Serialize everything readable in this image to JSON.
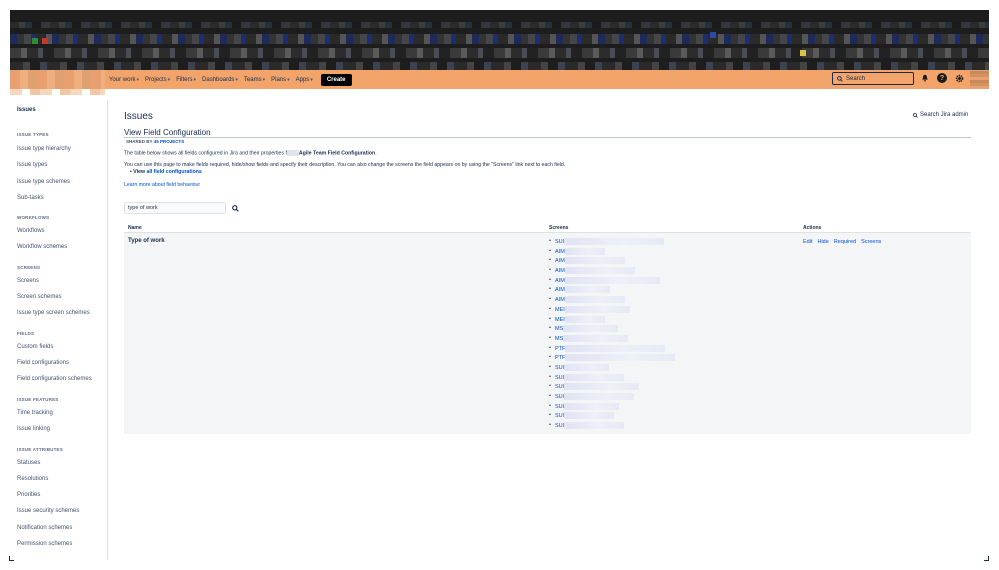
{
  "topnav": {
    "items": [
      {
        "label": "Your work"
      },
      {
        "label": "Projects"
      },
      {
        "label": "Filters"
      },
      {
        "label": "Dashboards"
      },
      {
        "label": "Teams"
      },
      {
        "label": "Plans"
      },
      {
        "label": "Apps"
      }
    ],
    "create_label": "Create",
    "search_placeholder": "Search",
    "icons": [
      "notifications-icon",
      "help-icon",
      "settings-icon"
    ],
    "nav_color": "#f3a46b"
  },
  "sidebar": {
    "title": "Issues",
    "sections": [
      {
        "heading": "ISSUE TYPES",
        "items": [
          "Issue type hierarchy",
          "Issue types",
          "Issue type schemes",
          "Sub-tasks"
        ]
      },
      {
        "heading": "WORKFLOWS",
        "items": [
          "Workflows",
          "Workflow schemes"
        ]
      },
      {
        "heading": "SCREENS",
        "items": [
          "Screens",
          "Screen schemes",
          "Issue type screen schemes"
        ]
      },
      {
        "heading": "FIELDS",
        "items": [
          "Custom fields",
          "Field configurations",
          "Field configuration schemes"
        ]
      },
      {
        "heading": "ISSUE FEATURES",
        "items": [
          "Time tracking",
          "Issue linking"
        ]
      },
      {
        "heading": "ISSUE ATTRIBUTES",
        "items": [
          "Statuses",
          "Resolutions",
          "Priorities",
          "Issue security schemes",
          "Notification schemes",
          "Permission schemes"
        ]
      }
    ]
  },
  "main": {
    "page_title": "Issues",
    "search_admin": "Search Jira admin",
    "sub_title": "View Field Configuration",
    "shared_by_prefix": "SHARED BY",
    "shared_by_link": "45 PROJECTS",
    "desc1_prefix": "The table below shows all fields configured in Jira and their properties f",
    "desc1_bold": "Agile Team Field Configuration",
    "desc1_suffix": ".",
    "desc2": "You can use this page to make fields required, hide/show fields and specify their description. You can also change the screens the field appears on by using the \"Screens\" link next to each field.",
    "view_all_prefix": "View",
    "view_all_link": "all field configurations",
    "learn_more": "Learn more about field behaviour",
    "filter_value": "type of work"
  },
  "table": {
    "headers": [
      "Name",
      "Screens",
      "Actions"
    ],
    "row": {
      "name": "Type of work",
      "screens": [
        "SUI",
        "AIM",
        "AIM",
        "AIM",
        "AIM",
        "AIM",
        "AIM",
        "MEI",
        "MEI",
        "MS",
        "MS",
        "PTF",
        "PTF",
        "SUI",
        "SUI",
        "SUI",
        "SUI",
        "SUI",
        "SUI",
        "SUI"
      ],
      "actions": [
        "Edit",
        "Hide",
        "Required",
        "Screens"
      ]
    }
  }
}
